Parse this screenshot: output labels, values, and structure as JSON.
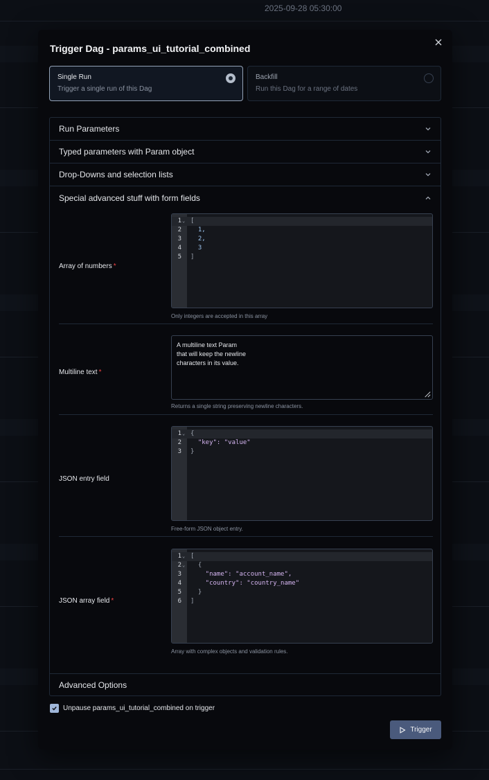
{
  "background": {
    "timestamp": "2025-09-28 05:30:00"
  },
  "modal": {
    "title": "Trigger Dag - params_ui_tutorial_combined",
    "run_modes": [
      {
        "title": "Single Run",
        "desc": "Trigger a single run of this Dag",
        "selected": true
      },
      {
        "title": "Backfill",
        "desc": "Run this Dag for a range of dates",
        "selected": false
      }
    ],
    "sections": {
      "run_parameters": "Run Parameters",
      "typed_params": "Typed parameters with Param object",
      "dropdowns": "Drop-Downs and selection lists",
      "special": "Special advanced stuff with form fields",
      "advanced": "Advanced Options"
    },
    "fields": {
      "array_numbers": {
        "label": "Array of numbers",
        "required": "*",
        "helper": "Only integers are accepted in this array",
        "lines": [
          "[",
          "  1,",
          "  2,",
          "  3",
          "]"
        ]
      },
      "multiline": {
        "label": "Multiline text",
        "required": "*",
        "value": "A multiline text Param\nthat will keep the newline\ncharacters in its value.",
        "helper": "Returns a single string preserving newline characters."
      },
      "json_entry": {
        "label": "JSON entry field",
        "helper": "Free-form JSON object entry.",
        "lines": [
          "{",
          "  \"key\": \"value\"",
          "}"
        ]
      },
      "json_array": {
        "label": "JSON array field",
        "required": "*",
        "helper": "Array with complex objects and validation rules.",
        "lines": [
          "[",
          "  {",
          "    \"name\": \"account_name\",",
          "    \"country\": \"country_name\"",
          "  }",
          "]"
        ]
      }
    },
    "unpause_label": "Unpause params_ui_tutorial_combined on trigger",
    "unpause_checked": true,
    "trigger_label": "Trigger"
  }
}
